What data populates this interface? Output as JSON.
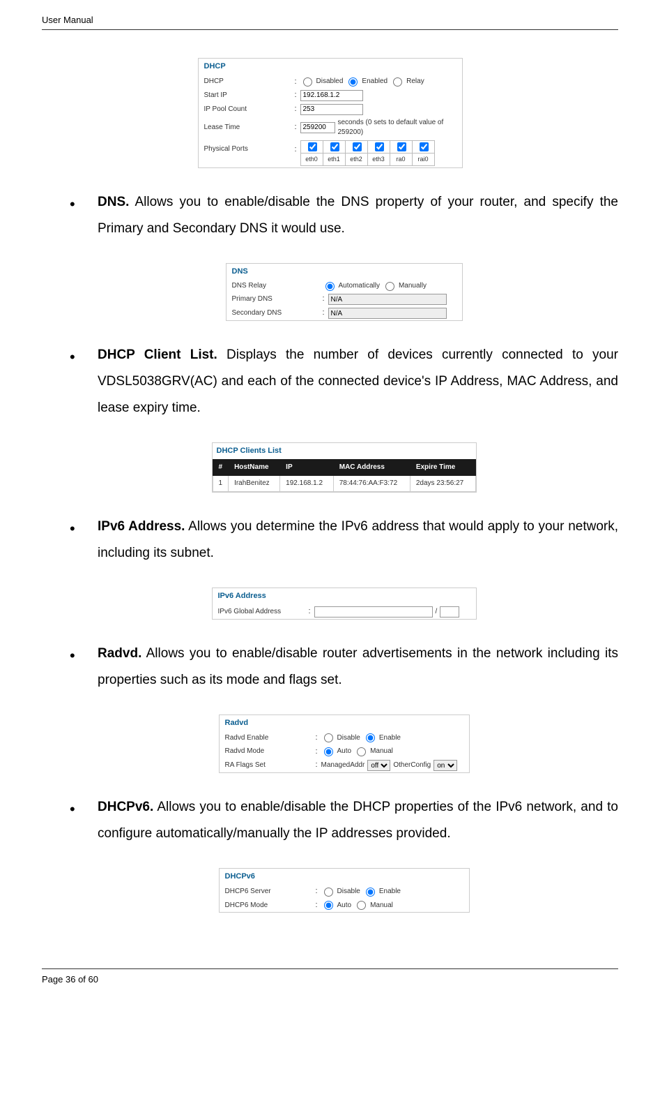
{
  "header": {
    "title": "User Manual"
  },
  "footer": {
    "page_label": "Page ",
    "page_now": "36",
    "page_of": " of 60"
  },
  "sections": {
    "dns_bullet_lead": "DNS.",
    "dns_bullet_text": " Allows you to enable/disable the DNS property of your router, and specify the Primary and Secondary DNS it would use.",
    "dhcp_client_lead": "DHCP Client List.",
    "dhcp_client_text": " Displays the number of devices currently connected to your VDSL5038GRV(AC) and each of the connected device's IP Address, MAC Address, and lease expiry time.",
    "ipv6_lead": "IPv6 Address.",
    "ipv6_text": " Allows you determine the IPv6 address that would apply to your network, including its subnet.",
    "radvd_lead": "Radvd.",
    "radvd_text": " Allows you to enable/disable router advertisements in the network including its properties such as its mode and flags set.",
    "dhcpv6_lead": "DHCPv6.",
    "dhcpv6_text": " Allows you to enable/disable the DHCP properties of the IPv6 network, and to configure automatically/manually the IP addresses provided."
  },
  "fig_dhcp": {
    "title": "DHCP",
    "rows": {
      "dhcp_label": "DHCP",
      "dhcp_opts": {
        "disabled": "Disabled",
        "enabled": "Enabled",
        "relay": "Relay"
      },
      "start_ip_label": "Start IP",
      "start_ip_value": "192.168.1.2",
      "pool_label": "IP Pool Count",
      "pool_value": "253",
      "lease_label": "Lease Time",
      "lease_value": "259200",
      "lease_hint": "seconds (0 sets to default value of 259200)",
      "ports_label": "Physical Ports",
      "ports": [
        "eth0",
        "eth1",
        "eth2",
        "eth3",
        "ra0",
        "rai0"
      ]
    }
  },
  "fig_dns": {
    "title": "DNS",
    "relay_label": "DNS Relay",
    "relay_opts": {
      "auto": "Automatically",
      "manual": "Manually"
    },
    "primary_label": "Primary DNS",
    "primary_value": "N/A",
    "secondary_label": "Secondary DNS",
    "secondary_value": "N/A"
  },
  "fig_clients": {
    "title": "DHCP Clients List",
    "headers": {
      "num": "#",
      "host": "HostName",
      "ip": "IP",
      "mac": "MAC Address",
      "expire": "Expire Time"
    },
    "rows": [
      {
        "num": "1",
        "host": "IrahBenitez",
        "ip": "192.168.1.2",
        "mac": "78:44:76:AA:F3:72",
        "expire": "2days 23:56:27"
      }
    ]
  },
  "fig_ipv6": {
    "title": "IPv6 Address",
    "global_label": "IPv6 Global Address",
    "addr_value": "",
    "subnet_value": "",
    "slash": "/"
  },
  "fig_radvd": {
    "title": "Radvd",
    "enable_label": "Radvd Enable",
    "enable_opts": {
      "disable": "Disable",
      "enable": "Enable"
    },
    "mode_label": "Radvd Mode",
    "mode_opts": {
      "auto": "Auto",
      "manual": "Manual"
    },
    "flags_label": "RA Flags Set",
    "flags_managed": "ManagedAddr",
    "flags_managed_val": "off",
    "flags_other": "OtherConfig",
    "flags_other_val": "on"
  },
  "fig_dhcpv6": {
    "title": "DHCPv6",
    "server_label": "DHCP6 Server",
    "server_opts": {
      "disable": "Disable",
      "enable": "Enable"
    },
    "mode_label": "DHCP6 Mode",
    "mode_opts": {
      "auto": "Auto",
      "manual": "Manual"
    }
  }
}
